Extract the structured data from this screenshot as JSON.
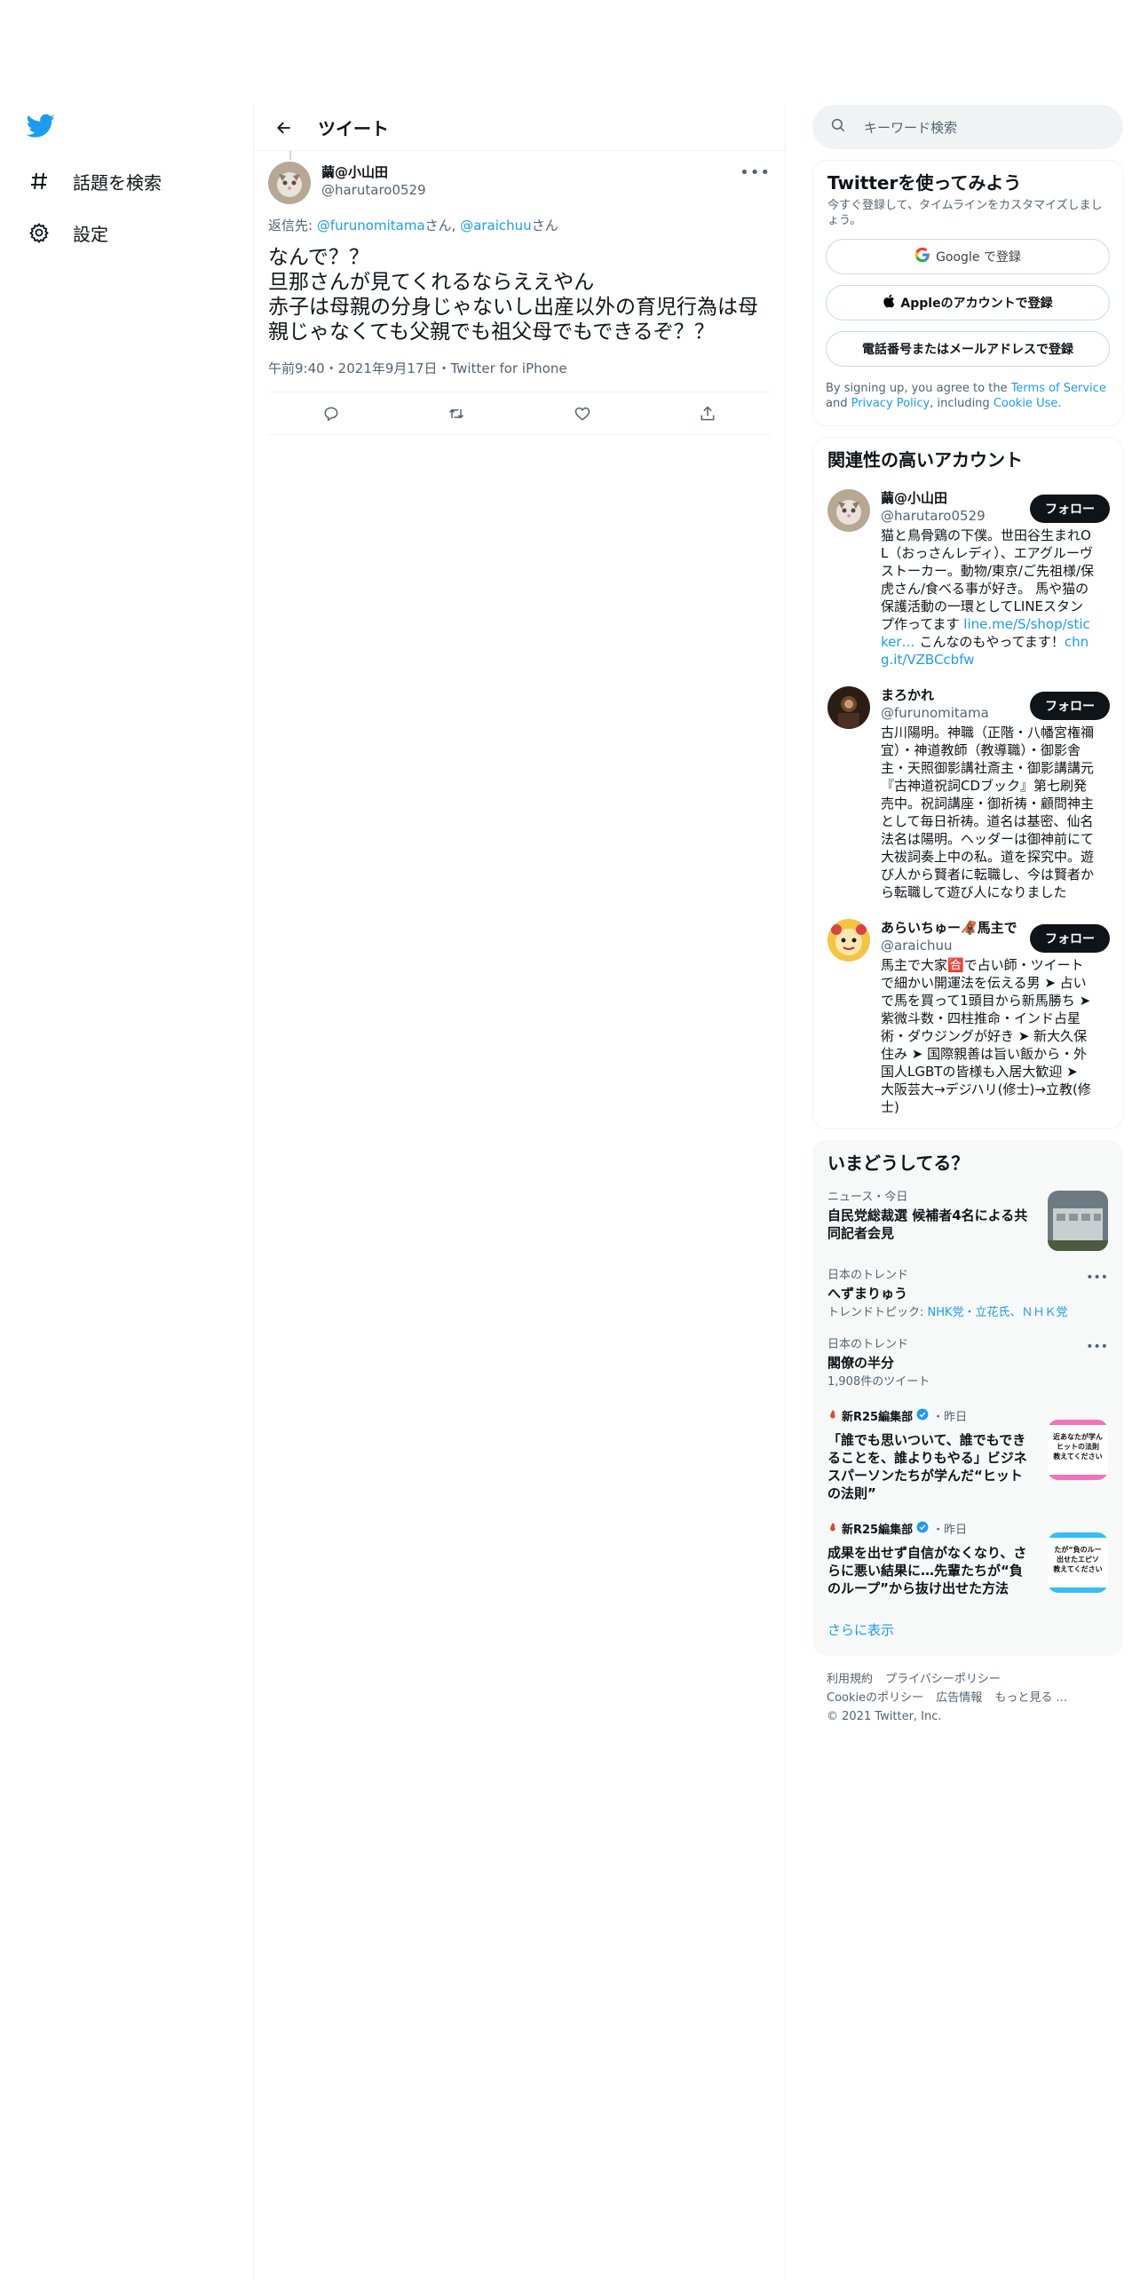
{
  "nav": {
    "explore_label": "話題を検索",
    "settings_label": "設定"
  },
  "main": {
    "title": "ツイート"
  },
  "tweet": {
    "author_name": "繭@小山田",
    "author_handle": "@harutaro0529",
    "reply_prefix": "返信先: ",
    "reply_mention_1": "@furunomitama",
    "reply_san_1": "さん, ",
    "reply_mention_2": "@araichuu",
    "reply_san_2": "さん",
    "text": "なんで？？\n旦那さんが見てくれるならええやん\n赤子は母親の分身じゃないし出産以外の育児行為は母親じゃなくても父親でも祖父母でもできるぞ？？",
    "meta": "午前9:40・2021年9月17日・Twitter for iPhone"
  },
  "search": {
    "placeholder": "キーワード検索"
  },
  "signup": {
    "title": "Twitterを使ってみよう",
    "subtitle": "今すぐ登録して、タイムラインをカスタマイズしましょう。",
    "google_label": "Google で登録",
    "apple_label": "Appleのアカウントで登録",
    "phone_label": "電話番号またはメールアドレスで登録",
    "terms_1": "By signing up, you agree to the ",
    "terms_tos": "Terms of Service",
    "terms_2": " and ",
    "terms_privacy": "Privacy Policy",
    "terms_3": ", including ",
    "terms_cookie": "Cookie Use",
    "terms_4": "."
  },
  "relevant": {
    "title": "関連性の高いアカウント",
    "follow_label": "フォロー",
    "accounts": [
      {
        "name": "繭@小山田",
        "handle": "@harutaro0529",
        "bio": "猫と鳥骨鶏の下僕。世田谷生まれOL（おっさんレディ）、エアグルーヴストーカー。動物/東京/ご先祖様/保虎さん/食べる事が好き。 馬や猫の保護活動の一環としてLINEスタンプ作ってます ",
        "link1": "line.me/S/shop/sticker…",
        "bio2": " こんなのもやってます！",
        "link2": "chng.it/VZBCcbfw"
      },
      {
        "name": "まろかれ",
        "handle": "@furunomitama",
        "bio": "古川陽明。神職（正階・八幡宮権禰宜）・神道教師（教導職）・御影舎主・天照御影講社斎主・御影講講元『古神道祝詞CDブック』第七刷発売中。祝詞講座・御祈祷・顧問神主として毎日祈祷。道名は基密、仙名法名は陽明。ヘッダーは御神前にて大祓詞奏上中の私。道を探究中。遊び人から賢者に転職し、今は賢者から転職して遊び人になりました"
      },
      {
        "name": "あらいちゅー🦧馬主で",
        "handle": "@araichuu",
        "bio": "馬主で大家🈴で占い師・ツイートで細かい開運法を伝える男 ➤ 占いで馬を買って1頭目から新馬勝ち ➤ 紫微斗数・四柱推命・インド占星術・ダウジングが好き ➤ 新大久保住み ➤ 国際親善は旨い飯から・外国人LGBTの皆様も入居大歓迎 ➤ 大阪芸大→デジハリ(修士)→立教(修士)"
      }
    ]
  },
  "trends": {
    "title": "いまどうしてる？",
    "items": [
      {
        "meta": "ニュース・今日",
        "title": "自民党総裁選 候補者4名による共同記者会見"
      },
      {
        "meta": "日本のトレンド",
        "title": "へずまりゅう",
        "sub_prefix": "トレンドトピック: ",
        "sub_links": "NHK党・立花氏、ＮＨＫ党"
      },
      {
        "meta": "日本のトレンド",
        "title": "閣僚の半分",
        "sub": "1,908件のツイート"
      },
      {
        "source": "新R25編集部",
        "time": "・昨日",
        "title": "「誰でも思いついて、誰でもできることを、誰よりもやる」ビジネスパーソンたちが学んだ“ヒットの法則”",
        "thumb_text": "近あなたが学んヒットの法則教えてください"
      },
      {
        "source": "新R25編集部",
        "time": "・昨日",
        "title": "成果を出せず自信がなくなり、さらに悪い結果に…先輩たちが“負のループ”から抜け出せた方法",
        "thumb_text": "たが“負のルー出せたエピソ教えてください"
      }
    ],
    "show_more": "さらに表示"
  },
  "footer": {
    "links_row1": [
      "利用規約",
      "プライバシーポリシー"
    ],
    "links_row2": [
      "Cookieのポリシー",
      "広告情報",
      "もっと見る ..."
    ],
    "copyright": "© 2021 Twitter, Inc."
  },
  "colors": {
    "accent": "#1d9bf0",
    "text": "#0f1419",
    "secondary": "#536471",
    "border": "#eff3f4"
  }
}
